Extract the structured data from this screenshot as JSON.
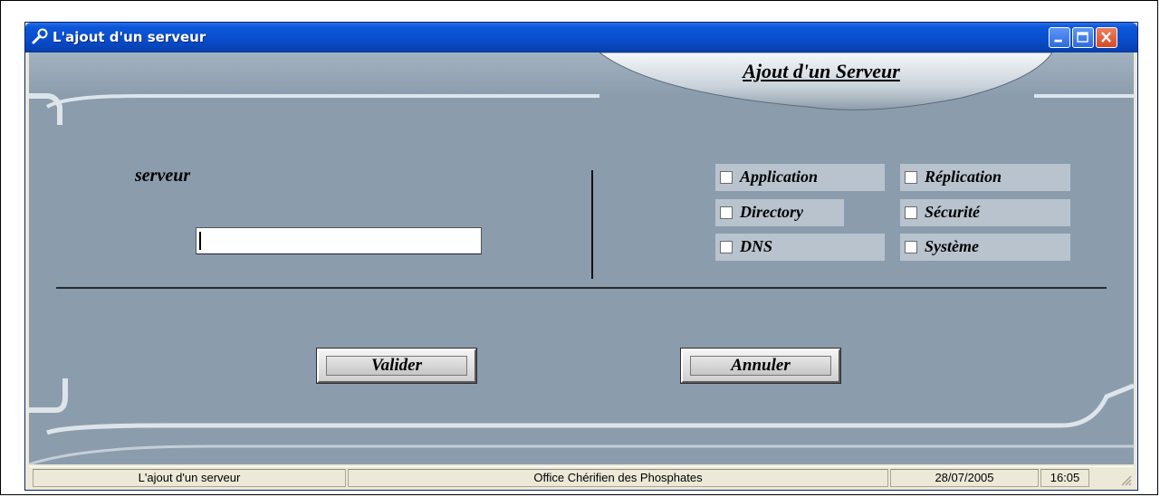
{
  "window": {
    "title": "L'ajout d'un serveur",
    "icon": "wrench-icon"
  },
  "header": {
    "title": "Ajout d'un Serveur"
  },
  "form": {
    "server_label": "serveur",
    "server_value": "",
    "checkboxes": [
      {
        "label": "Application",
        "checked": false
      },
      {
        "label": "Réplication",
        "checked": false
      },
      {
        "label": "Directory",
        "checked": false
      },
      {
        "label": "Sécurité",
        "checked": false
      },
      {
        "label": "DNS",
        "checked": false
      },
      {
        "label": "Système",
        "checked": false
      }
    ]
  },
  "buttons": {
    "validate_label": "Valider",
    "cancel_label": "Annuler"
  },
  "statusbar": {
    "panel1": "L'ajout d'un serveur",
    "panel2": "Office Chérifien des Phosphates",
    "date": "28/07/2005",
    "time": "16:05"
  },
  "colors": {
    "client_background": "#8b9cad",
    "titlebar": "#0a4fcf",
    "close_button": "#d84a25"
  }
}
